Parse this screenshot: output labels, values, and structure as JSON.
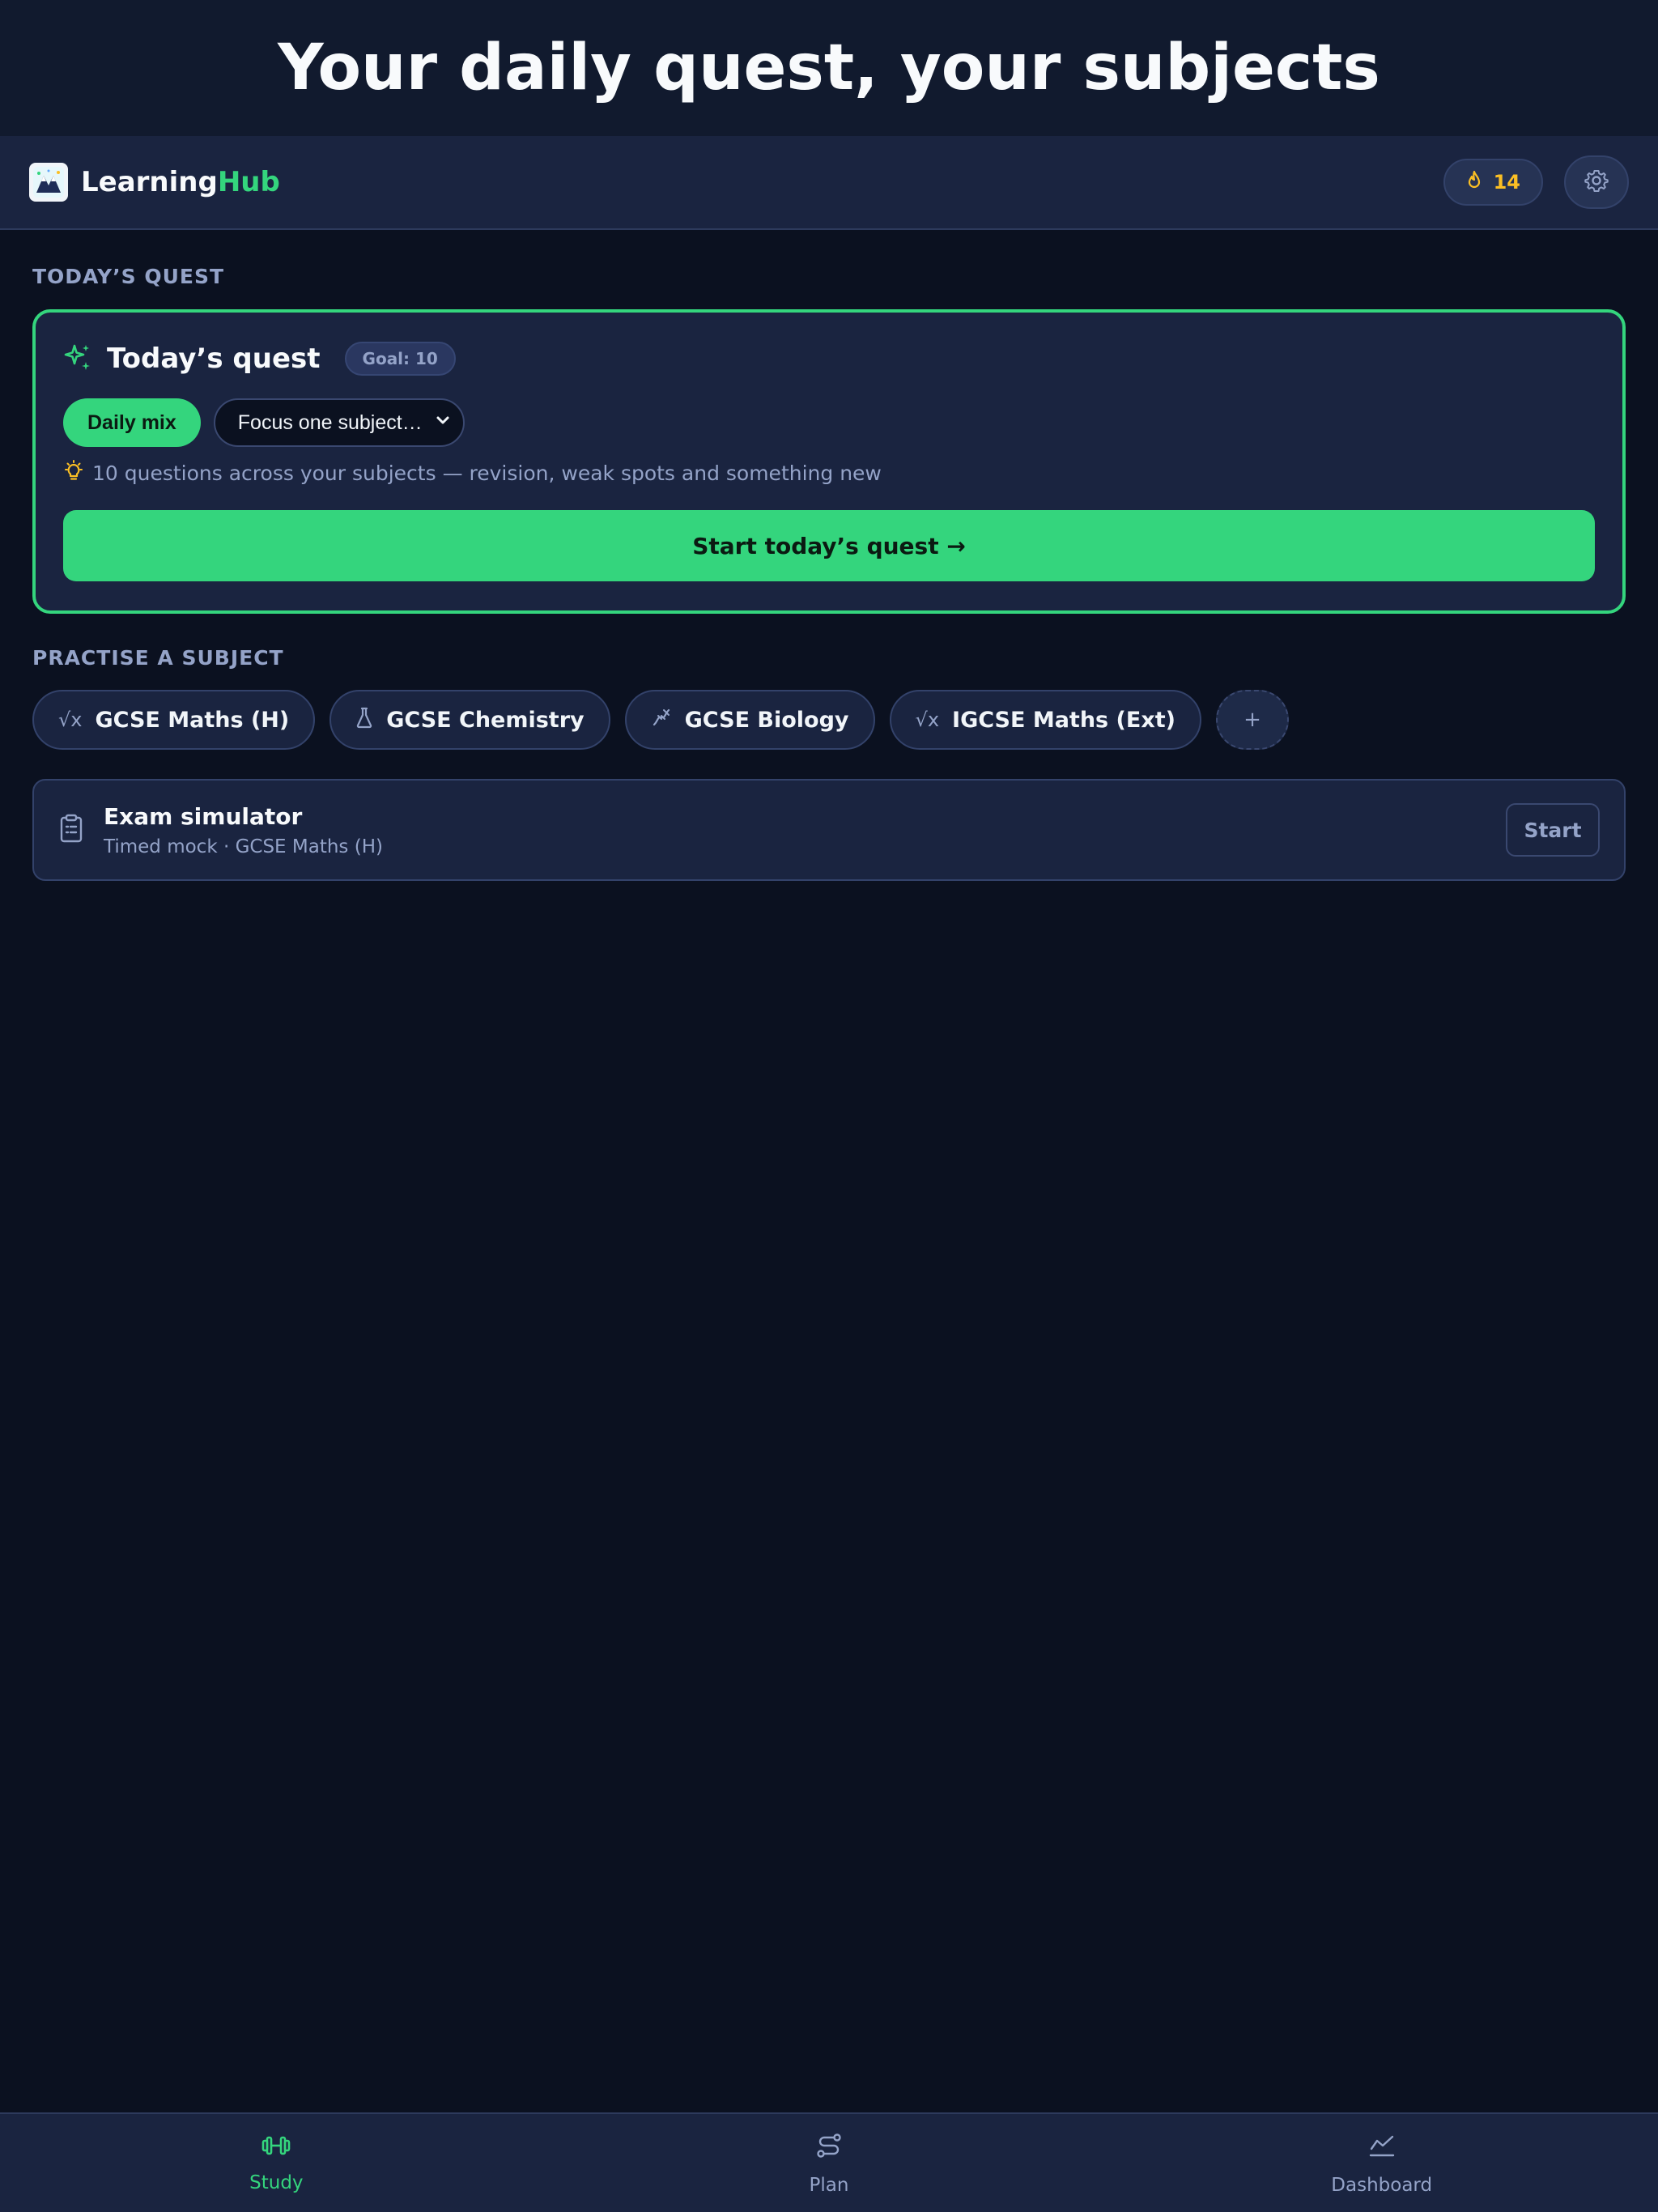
{
  "banner": {
    "headline": "Your daily quest, your subjects"
  },
  "header": {
    "brand_main": "Learning",
    "brand_accent": "Hub",
    "streak_count": "14",
    "icons": {
      "logo": "mountain-logo-icon",
      "streak": "flame-icon",
      "settings": "gear-icon"
    }
  },
  "quest": {
    "section_label": "TODAY’S QUEST",
    "title": "Today’s quest",
    "goal": "Goal: 10",
    "mode_daily": "Daily mix",
    "focus_placeholder": "Focus one subject…",
    "hint": "10 questions across your subjects — revision, weak spots and something new",
    "start_label": "Start today’s quest →",
    "icons": {
      "title": "sparkles-icon",
      "hint": "lightbulb-icon"
    }
  },
  "practise": {
    "section_label": "PRACTISE A SUBJECT",
    "subjects": [
      {
        "label": "GCSE Maths (H)",
        "icon": "sqrt-icon",
        "symbol": "√x"
      },
      {
        "label": "GCSE Chemistry",
        "icon": "flask-icon",
        "symbol": ""
      },
      {
        "label": "GCSE Biology",
        "icon": "dna-icon",
        "symbol": ""
      },
      {
        "label": "IGCSE Maths (Ext)",
        "icon": "sqrt-icon",
        "symbol": "√x"
      }
    ],
    "add_label": "+"
  },
  "exam": {
    "title": "Exam simulator",
    "subtitle": "Timed mock · GCSE Maths (H)",
    "start_label": "Start",
    "icon": "clipboard-icon"
  },
  "nav": {
    "items": [
      {
        "label": "Study",
        "icon": "dumbbell-icon",
        "active": true
      },
      {
        "label": "Plan",
        "icon": "route-icon",
        "active": false
      },
      {
        "label": "Dashboard",
        "icon": "trend-chart-icon",
        "active": false
      }
    ]
  },
  "colors": {
    "accent": "#34d57d",
    "background": "#0b1120",
    "surface": "#1a2440",
    "muted_text": "#94a3c8",
    "streak": "#fbbf24"
  }
}
